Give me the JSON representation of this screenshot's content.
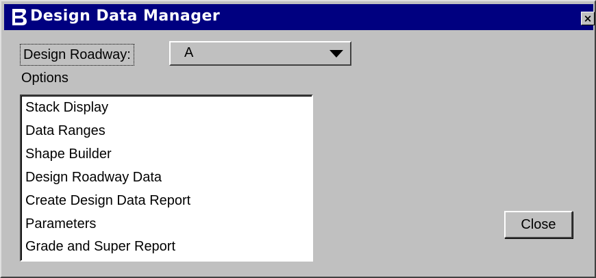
{
  "window": {
    "title": "Design Data Manager",
    "close_glyph": "×",
    "app_icon": "bentley-logo-icon"
  },
  "roadway": {
    "label": "Design Roadway:",
    "selected_value": "A"
  },
  "options": {
    "label": "Options",
    "items": [
      "Stack Display",
      "Data Ranges",
      "Shape Builder",
      "Design Roadway Data",
      "Create Design Data Report",
      "Parameters",
      "Grade and Super Report"
    ]
  },
  "buttons": {
    "close_label": "Close"
  },
  "colors": {
    "titlebar": "#000080",
    "face": "#c0c0c0",
    "list_bg": "#ffffff"
  }
}
